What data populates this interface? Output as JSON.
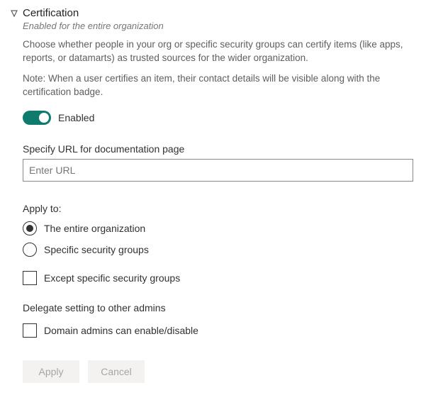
{
  "header": {
    "title": "Certification",
    "subtitle": "Enabled for the entire organization"
  },
  "description": "Choose whether people in your org or specific security groups can certify items (like apps, reports, or datamarts) as trusted sources for the wider organization.",
  "note": "Note: When a user certifies an item, their contact details will be visible along with the certification badge.",
  "toggle": {
    "state_label": "Enabled"
  },
  "url_field": {
    "label": "Specify URL for documentation page",
    "placeholder": "Enter URL",
    "value": ""
  },
  "apply_to": {
    "label": "Apply to:",
    "options": {
      "entire_org": "The entire organization",
      "specific_groups": "Specific security groups"
    },
    "except_label": "Except specific security groups"
  },
  "delegate": {
    "label": "Delegate setting to other admins",
    "option": "Domain admins can enable/disable"
  },
  "buttons": {
    "apply": "Apply",
    "cancel": "Cancel"
  }
}
